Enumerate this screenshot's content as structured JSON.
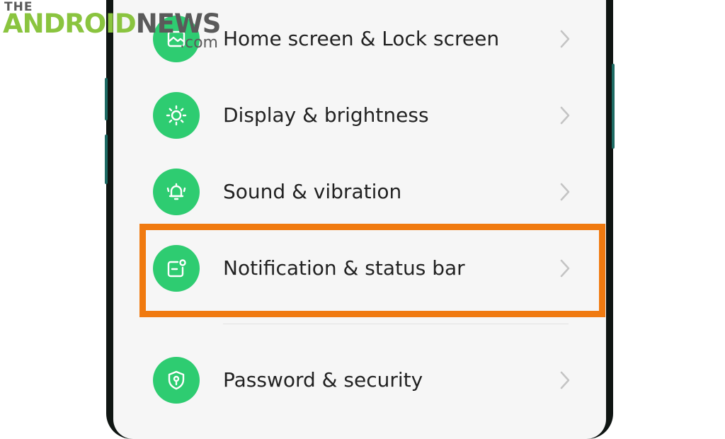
{
  "watermark": {
    "the": "THE",
    "android": "ANDROID",
    "news": "NEWS",
    "com": ".com"
  },
  "settings": {
    "items": [
      {
        "label": "Home screen & Lock screen",
        "icon": "home-lock-icon"
      },
      {
        "label": "Display & brightness",
        "icon": "brightness-icon"
      },
      {
        "label": "Sound & vibration",
        "icon": "bell-icon"
      },
      {
        "label": "Notification & status bar",
        "icon": "notification-icon",
        "highlighted": true
      },
      {
        "label": "Password & security",
        "icon": "shield-lock-icon"
      }
    ]
  },
  "colors": {
    "icon_background": "#2ecc71",
    "highlight_border": "#f07a10",
    "text": "#222222",
    "chevron": "#c4c4c4"
  }
}
